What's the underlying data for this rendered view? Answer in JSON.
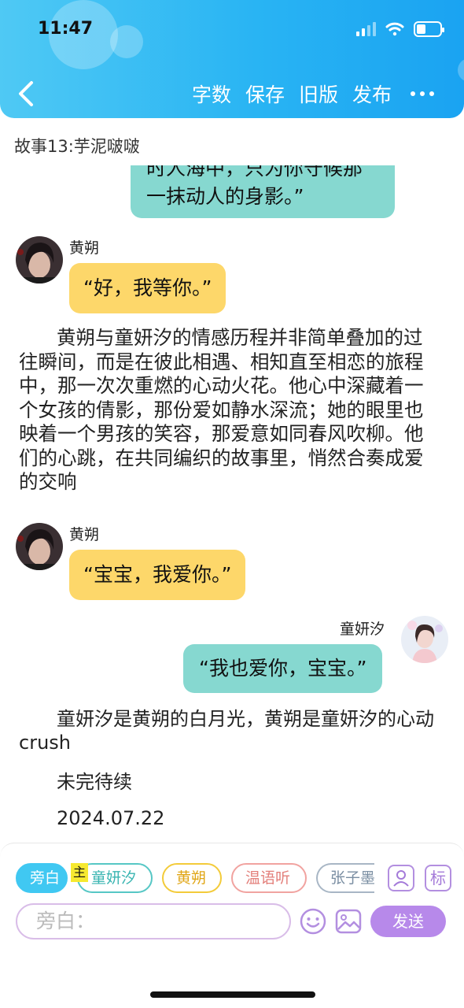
{
  "status_bar": {
    "time": "11:47"
  },
  "toolbar": {
    "word_count": "字数",
    "save": "保存",
    "old_version": "旧版",
    "publish": "发布"
  },
  "story": {
    "title": "故事13:芋泥啵啵"
  },
  "messages": {
    "partial_teal": {
      "line1": "时人海中，只为你守候那",
      "line2": "一抹动人的身影。”"
    },
    "msg1": {
      "speaker": "黄朔",
      "text": "“好，我等你。”"
    },
    "narration1": "黄朔与童妍汐的情感历程并非简单叠加的过往瞬间，而是在彼此相遇、相知直至相恋的旅程中，那一次次重燃的心动火花。他心中深藏着一个女孩的倩影，那份爱如静水深流；她的眼里也映着一个男孩的笑容，那爱意如同春风吹柳。他们的心跳，在共同编织的故事里，悄然合奏成爱的交响",
    "msg2": {
      "speaker": "黄朔",
      "text": "“宝宝，我爱你。”"
    },
    "msg3": {
      "speaker": "童妍汐",
      "text": "“我也爱你，宝宝。”"
    },
    "narration2": "童妍汐是黄朔的白月光，黄朔是童妍汐的心动crush",
    "narration3": "未完待续",
    "narration4": "2024.07.22"
  },
  "roles": {
    "narrator": "旁白",
    "master_badge": "主",
    "tong": "童妍汐",
    "huang": "黄朔",
    "wen": "温语听",
    "zhang": "张子墨"
  },
  "input": {
    "placeholder": "旁白：",
    "send": "发送",
    "tag_icon_label": "标"
  },
  "colors": {
    "header": "#29b4f3",
    "teal_bubble": "#86d8d0",
    "yellow_bubble": "#fdd76a",
    "send": "#b789ea",
    "active_chip": "#40c8f2"
  }
}
